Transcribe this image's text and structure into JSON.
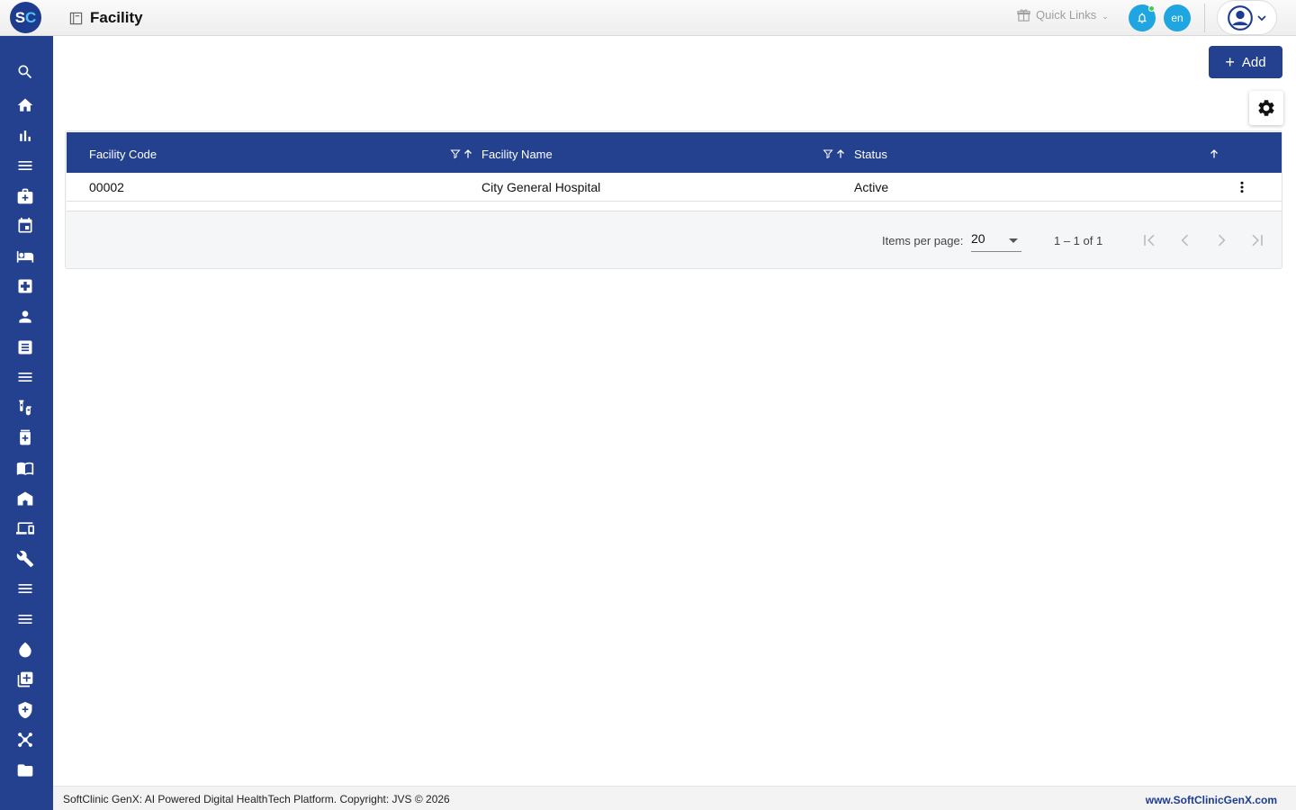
{
  "header": {
    "logo_s": "S",
    "logo_c": "C",
    "title": "Facility",
    "quick_links": "Quick Links",
    "lang": "en"
  },
  "sidebar": {
    "items": [
      {
        "icon": "search-icon"
      },
      {
        "icon": "home-icon"
      },
      {
        "icon": "bar-chart-icon"
      },
      {
        "icon": "menu-icon"
      },
      {
        "icon": "medical-bag-icon"
      },
      {
        "icon": "calendar-icon"
      },
      {
        "icon": "bed-icon"
      },
      {
        "icon": "medical-cross-icon"
      },
      {
        "icon": "person-icon"
      },
      {
        "icon": "receipt-icon"
      },
      {
        "icon": "menu-icon"
      },
      {
        "icon": "lab-tubes-icon"
      },
      {
        "icon": "pharmacy-icon"
      },
      {
        "icon": "book-icon"
      },
      {
        "icon": "store-icon"
      },
      {
        "icon": "devices-icon"
      },
      {
        "icon": "wrench-icon"
      },
      {
        "icon": "menu-icon"
      },
      {
        "icon": "menu-icon"
      },
      {
        "icon": "drop-icon"
      },
      {
        "icon": "add-box-icon"
      },
      {
        "icon": "shield-icon"
      },
      {
        "icon": "network-icon"
      },
      {
        "icon": "folder-icon"
      }
    ]
  },
  "toolbar": {
    "add_label": "Add"
  },
  "table": {
    "columns": [
      "Facility Code",
      "Facility Name",
      "Status"
    ],
    "rows": [
      {
        "code": "00002",
        "name": "City General Hospital",
        "status": "Active"
      }
    ]
  },
  "paginator": {
    "items_per_page_label": "Items per page:",
    "items_per_page_value": "20",
    "range": "1 – 1 of 1"
  },
  "footer": {
    "left": "SoftClinic GenX: AI Powered Digital HealthTech Platform. Copyright: JVS © 2026",
    "right": "www.SoftClinicGenX.com"
  },
  "colors": {
    "primary": "#24418f",
    "accent": "#1fa6e0",
    "online": "#3ccf4e"
  }
}
